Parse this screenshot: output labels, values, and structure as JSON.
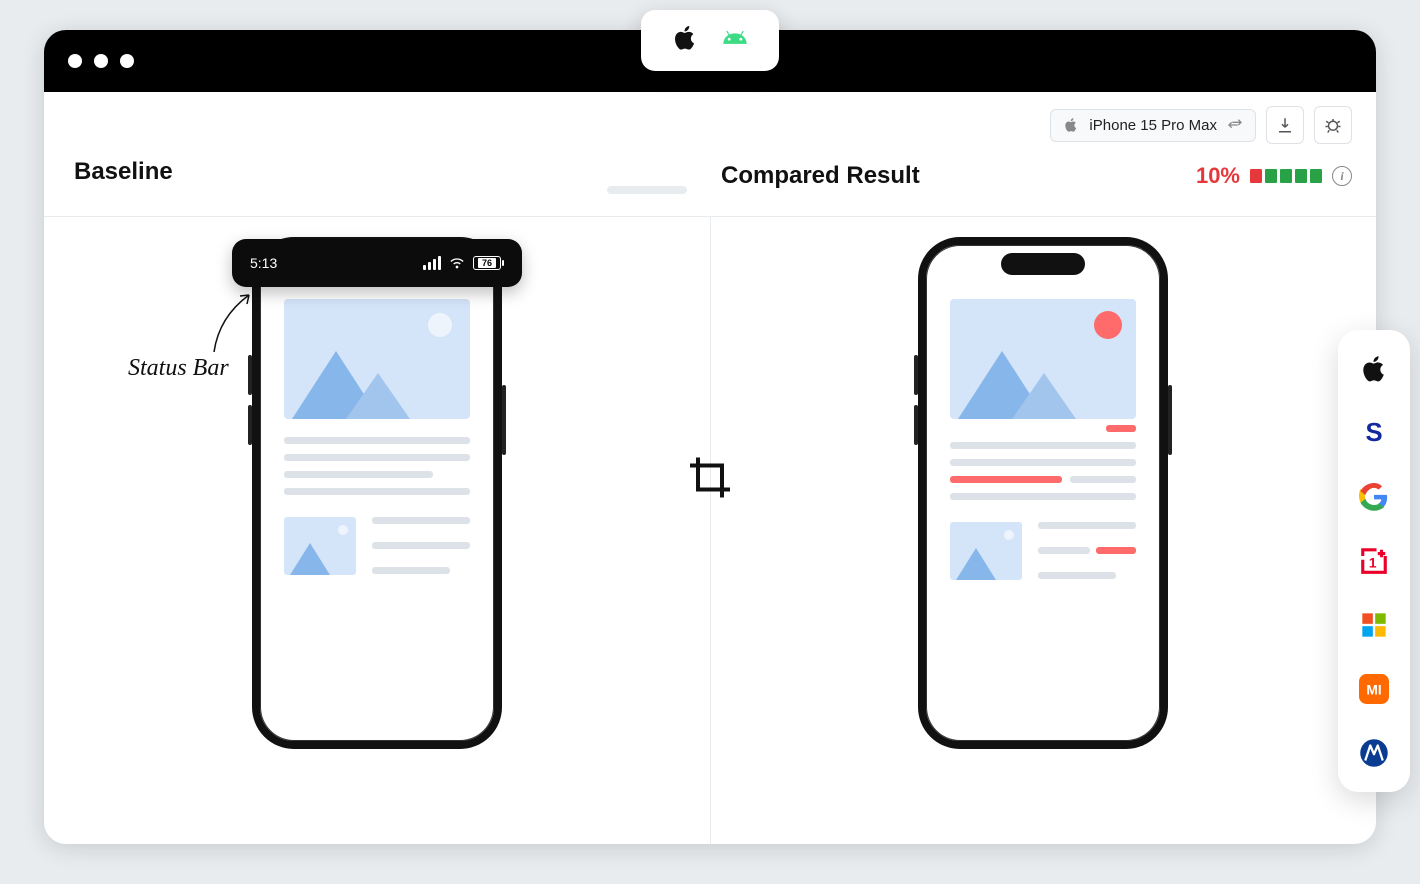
{
  "platform_pill": {
    "ios_icon": "apple-icon",
    "android_icon": "android-icon"
  },
  "toolbar": {
    "device_label": "iPhone 15 Pro Max"
  },
  "headers": {
    "baseline": "Baseline",
    "compared": "Compared Result",
    "diff_percent": "10%",
    "quality_colors": [
      "#e5383b",
      "#29a147",
      "#29a147",
      "#29a147",
      "#29a147"
    ]
  },
  "status_bar": {
    "time": "5:13",
    "battery_percent": "76"
  },
  "annotation": {
    "label": "Status Bar"
  },
  "brands": [
    "apple",
    "samsung",
    "google",
    "oneplus",
    "microsoft",
    "xiaomi",
    "motorola"
  ]
}
